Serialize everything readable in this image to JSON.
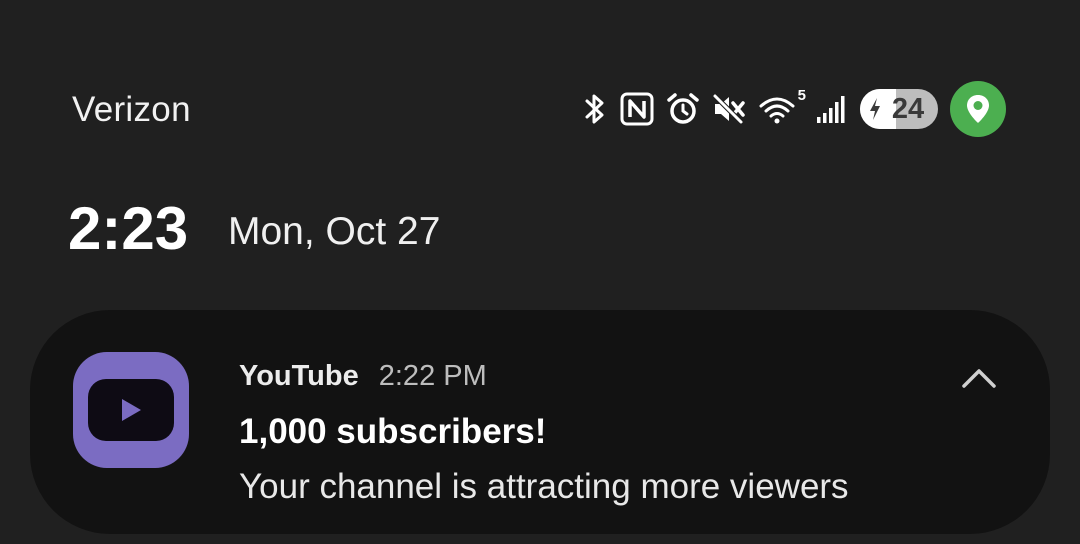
{
  "status_bar": {
    "carrier": "Verizon",
    "icons": [
      "bluetooth-icon",
      "nfc-icon",
      "alarm-icon",
      "mute-icon",
      "wifi-icon",
      "signal-icon",
      "battery-icon",
      "location-icon"
    ],
    "wifi_badge": "5",
    "battery_level": "24",
    "battery_fraction": 0.24,
    "battery_charging": true,
    "location_color": "#4caf50"
  },
  "clock": {
    "time": "2:23",
    "date": "Mon, Oct 27"
  },
  "notification": {
    "app_name": "YouTube",
    "time": "2:22 PM",
    "title": "1,000 subscribers!",
    "body": "Your channel is attracting more viewers",
    "icon": "youtube-app-icon",
    "icon_color": "#7b6cc2",
    "action_icon": "chevron-up-icon"
  }
}
